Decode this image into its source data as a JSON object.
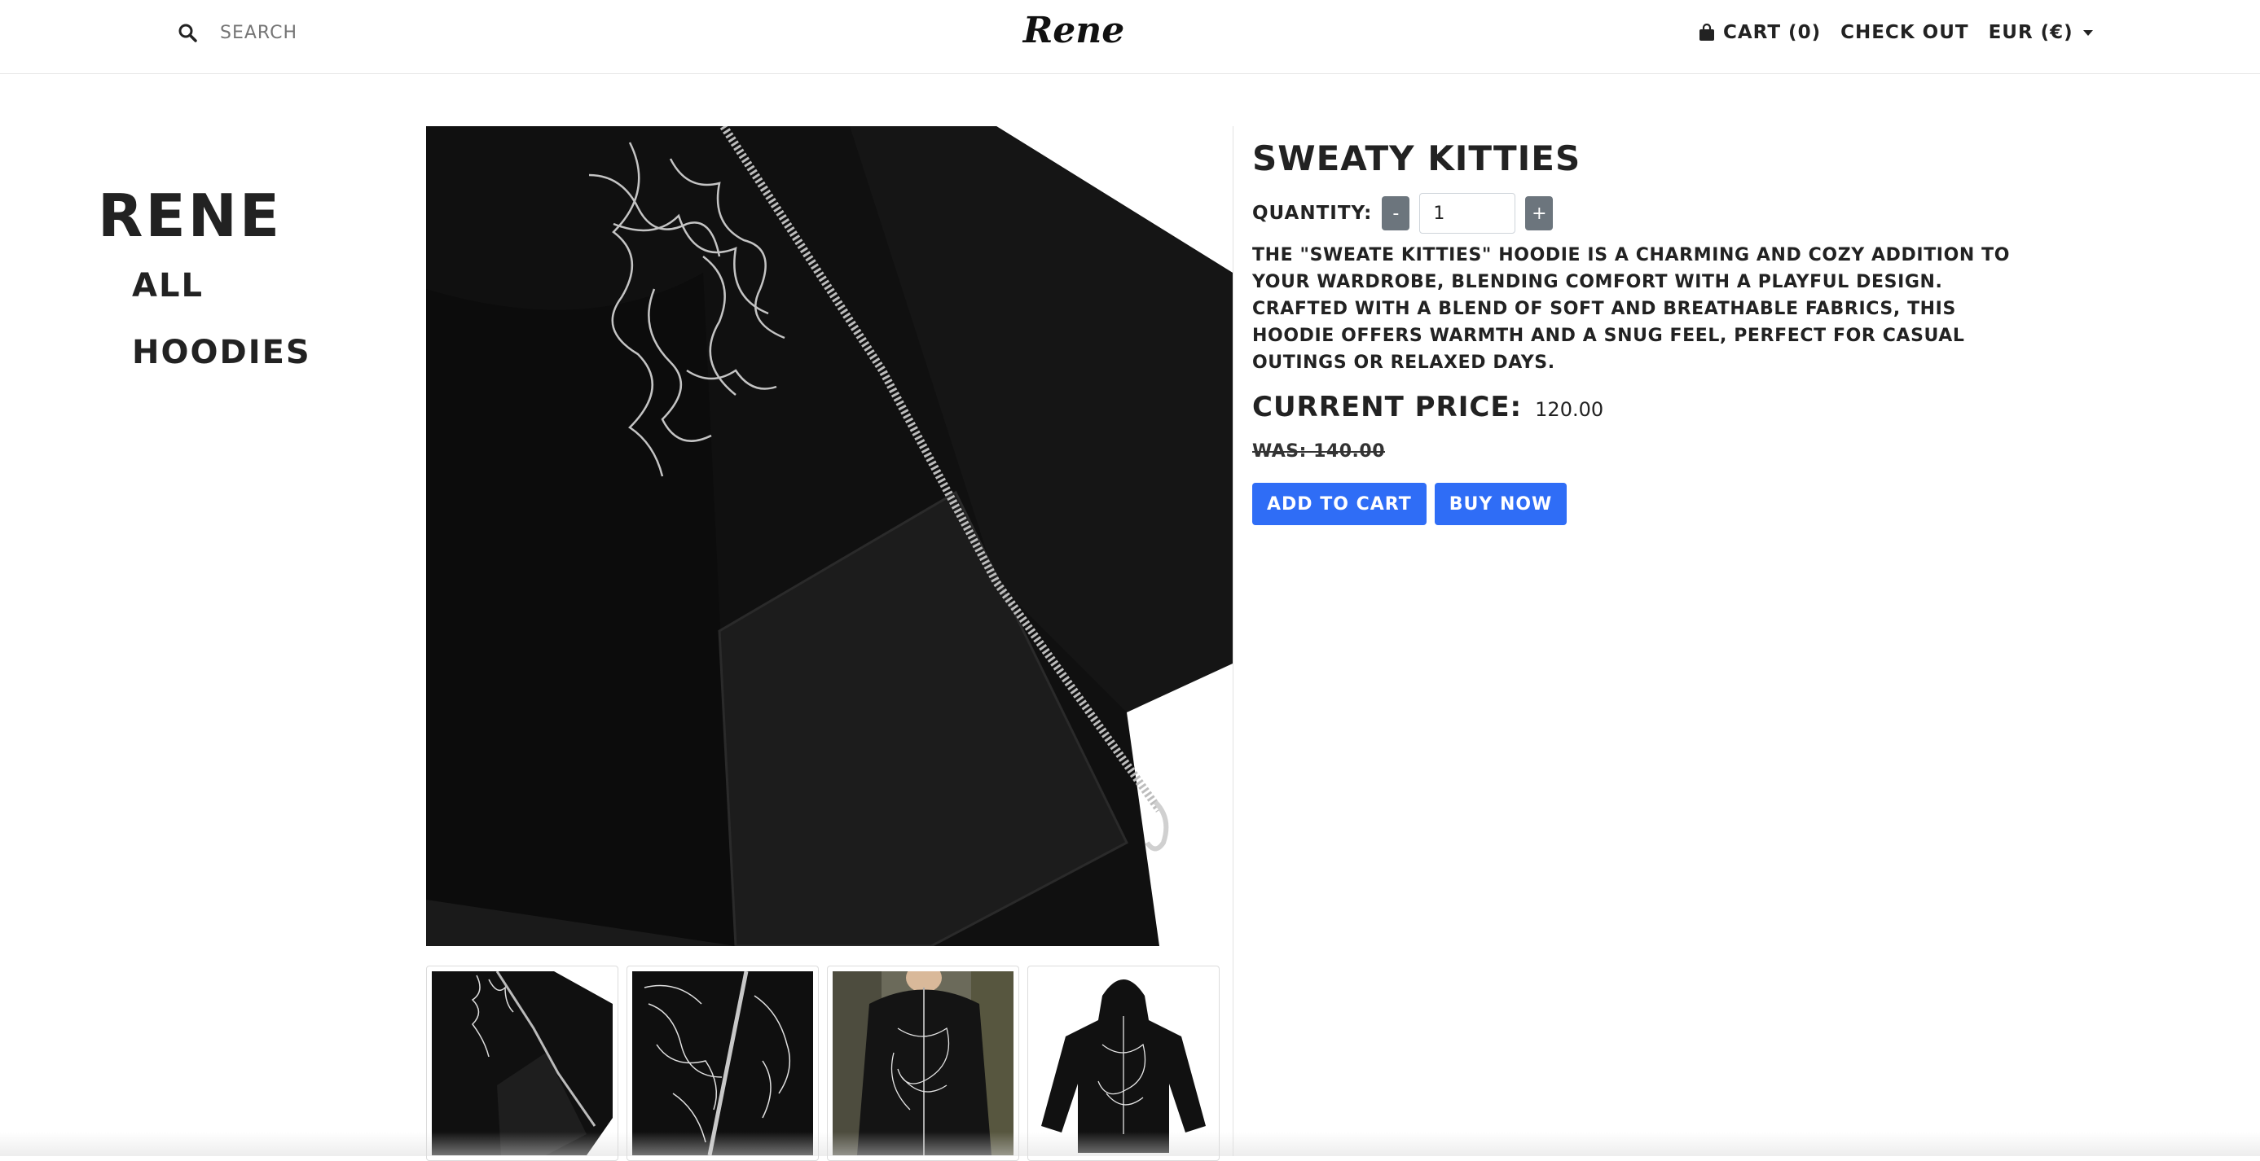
{
  "header": {
    "search_placeholder": "SEARCH",
    "logo_text": "Rene",
    "cart_label": "CART (0)",
    "checkout_label": "CHECK OUT",
    "currency_label": "EUR (€)"
  },
  "sidebar": {
    "brand": "RENE",
    "links": [
      {
        "label": "ALL"
      },
      {
        "label": "HOODIES"
      }
    ]
  },
  "product": {
    "title": "SWEATY KITTIES",
    "quantity_label": "QUANTITY:",
    "quantity_minus": "-",
    "quantity_plus": "+",
    "quantity_value": "1",
    "description": "THE \"SWEATE KITTIES\" HOODIE IS A CHARMING AND COZY ADDITION TO YOUR WARDROBE, BLENDING COMFORT WITH A PLAYFUL DESIGN. CRAFTED WITH A BLEND OF SOFT AND BREATHABLE FABRICS, THIS HOODIE OFFERS WARMTH AND A SNUG FEEL, PERFECT FOR CASUAL OUTINGS OR RELAXED DAYS.",
    "current_price_label": "CURRENT PRICE:",
    "current_price": "120.00",
    "was_price": "WAS: 140.00",
    "add_to_cart_label": "ADD TO CART",
    "buy_now_label": "BUY NOW"
  },
  "gallery": {
    "thumbnails": [
      {
        "name": "thumbnail-pocket-closeup"
      },
      {
        "name": "thumbnail-zipper-embroidery"
      },
      {
        "name": "thumbnail-model-worn"
      },
      {
        "name": "thumbnail-front-view"
      }
    ]
  },
  "colors": {
    "button_primary": "#2f6df6",
    "button_secondary": "#6c757d",
    "garment": "#0e0e0e"
  }
}
